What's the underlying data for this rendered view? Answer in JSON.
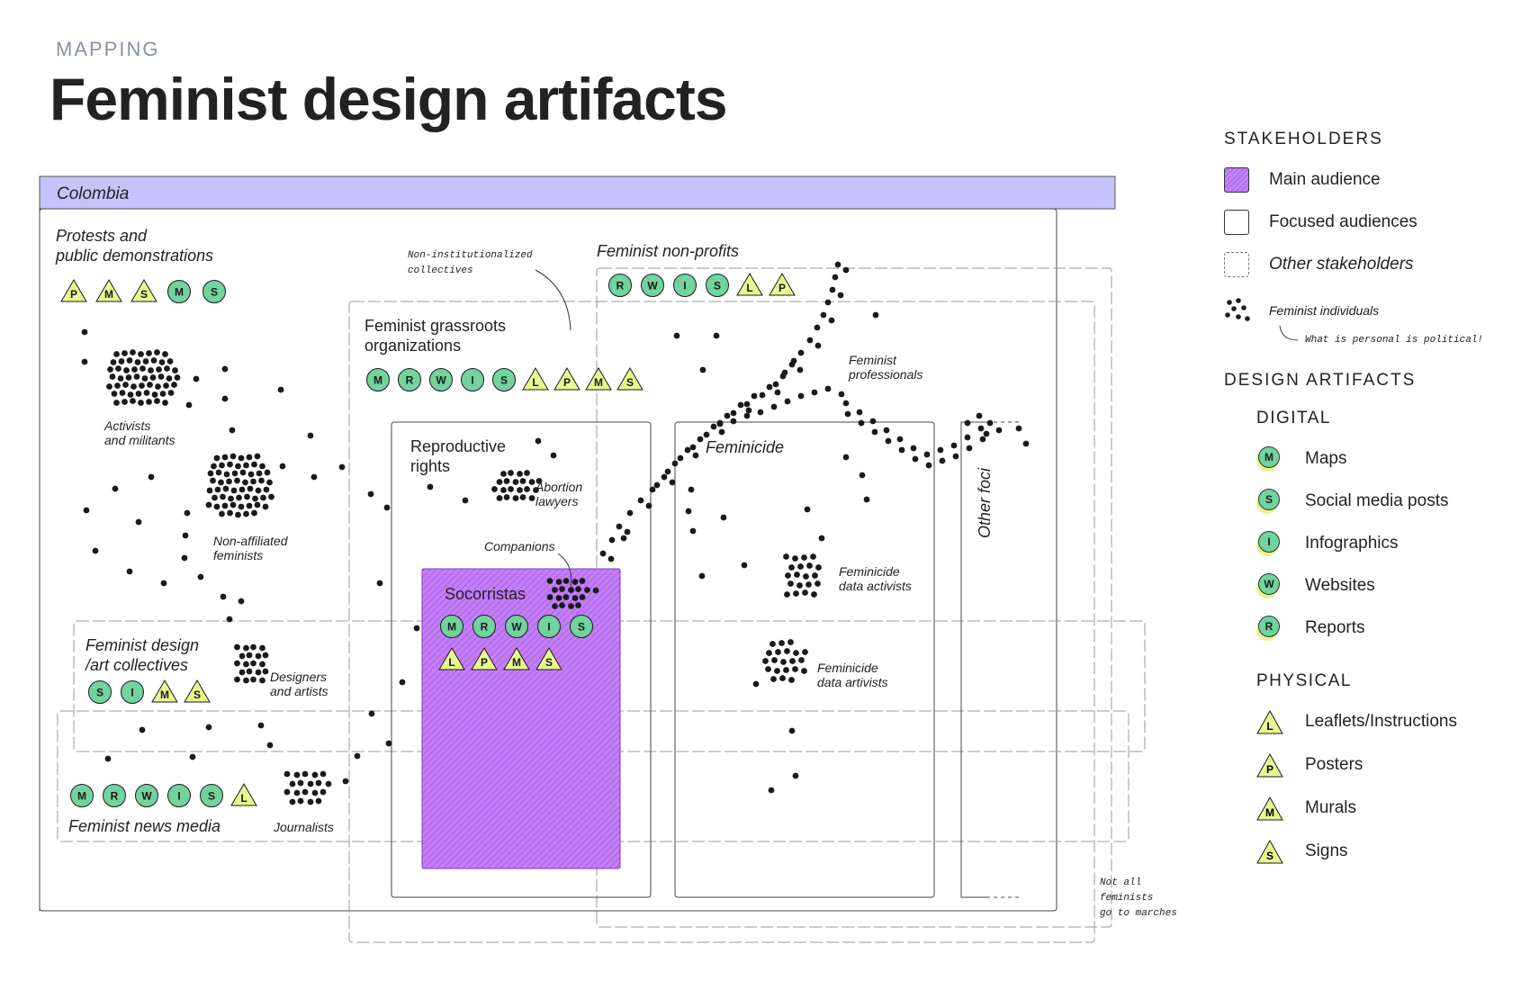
{
  "header": {
    "kicker": "MAPPING",
    "title": "Feminist design artifacts"
  },
  "country": "Colombia",
  "regions": {
    "protests": [
      "Protests and",
      "public demonstrations"
    ],
    "grassroots": [
      "Feminist grassroots",
      "organizations"
    ],
    "nonprofits": [
      "Feminist non-profits"
    ],
    "reproductive": [
      "Reproductive",
      "rights"
    ],
    "feminicide": [
      "Feminicide"
    ],
    "other_foci": [
      "Other foci"
    ],
    "design_collectives": [
      "Feminist design",
      "/art collectives"
    ],
    "news_media": [
      "Feminist news media"
    ],
    "socorristas": [
      "Socorristas"
    ]
  },
  "annotations": {
    "non_institutionalized": [
      "Non-institutionalized",
      "collectives"
    ],
    "not_all": [
      "Not all",
      "feminists",
      "go to marches"
    ],
    "activists": [
      "Activists",
      "and militants"
    ],
    "non_affiliated": [
      "Non-affiliated",
      "feminists"
    ],
    "designers": [
      "Designers",
      "and artists"
    ],
    "journalists": [
      "Journalists"
    ],
    "abortion": [
      "Abortion",
      "lawyers"
    ],
    "companions": [
      "Companions"
    ],
    "professionals": [
      "Feminist",
      "professionals"
    ],
    "data_activists": [
      "Feminicide",
      "data activists"
    ],
    "data_artivists": [
      "Feminicide",
      "data artivists"
    ]
  },
  "artifact_sets": {
    "protests": {
      "digital": [],
      "physical": [],
      "sequence": [
        "P:t",
        "M:t",
        "S:t",
        "M:c",
        "S:c"
      ]
    },
    "grassroots": {
      "sequence": [
        "M:c",
        "R:c",
        "W:c",
        "I:c",
        "S:c",
        "L:t",
        "P:t",
        "M:t",
        "S:t"
      ]
    },
    "nonprofits": {
      "sequence": [
        "R:c",
        "W:c",
        "I:c",
        "S:c",
        "L:t",
        "P:t"
      ]
    },
    "socorristas_digital": {
      "sequence": [
        "M:c",
        "R:c",
        "W:c",
        "I:c",
        "S:c"
      ]
    },
    "socorristas_physical": {
      "sequence": [
        "L:t",
        "P:t",
        "M:t",
        "S:t"
      ]
    },
    "design_collectives": {
      "sequence": [
        "S:c",
        "I:c",
        "M:t",
        "S:t"
      ]
    },
    "news_media": {
      "sequence": [
        "M:c",
        "R:c",
        "W:c",
        "I:c",
        "S:c",
        "L:t"
      ]
    }
  },
  "legend": {
    "stakeholders_title": "STAKEHOLDERS",
    "stakeholders": [
      {
        "kind": "main",
        "label": "Main audience"
      },
      {
        "kind": "focused",
        "label": "Focused audiences"
      },
      {
        "kind": "other",
        "label": "Other stakeholders"
      }
    ],
    "individuals_label": "Feminist individuals",
    "individuals_note": "What is personal is political!",
    "artifacts_title": "DESIGN ARTIFACTS",
    "digital_title": "DIGITAL",
    "digital": [
      {
        "letter": "M",
        "label": "Maps"
      },
      {
        "letter": "S",
        "label": "Social media posts"
      },
      {
        "letter": "I",
        "label": "Infographics"
      },
      {
        "letter": "W",
        "label": "Websites"
      },
      {
        "letter": "R",
        "label": "Reports"
      }
    ],
    "physical_title": "PHYSICAL",
    "physical": [
      {
        "letter": "L",
        "label": "Leaflets/Instructions"
      },
      {
        "letter": "P",
        "label": "Posters"
      },
      {
        "letter": "M",
        "label": "Murals"
      },
      {
        "letter": "S",
        "label": "Signs"
      }
    ]
  },
  "colors": {
    "country_band": "#c5c3fb",
    "main_audience": "#b877f3",
    "digital_badge": "#72d39e",
    "physical_badge": "#e9f78f",
    "ink": "#1a1a1a"
  }
}
